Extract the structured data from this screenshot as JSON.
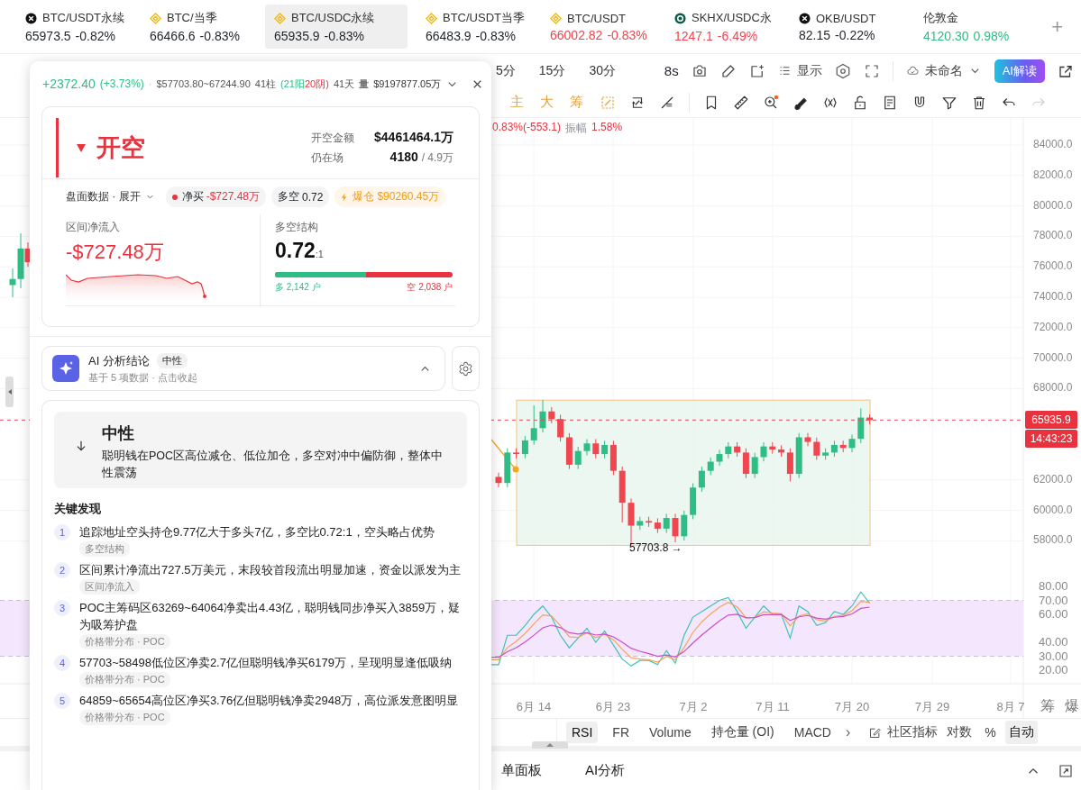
{
  "tickers": [
    {
      "kind": "xcircle",
      "symbol": "BTC/USDT永续",
      "price": "65973.5",
      "change": "-0.82%",
      "color": "#1f2329",
      "selected": false
    },
    {
      "kind": "diamond",
      "symbol": "BTC/当季",
      "price": "66466.6",
      "change": "-0.83%",
      "color": "#1f2329",
      "selected": false
    },
    {
      "kind": "diamond",
      "symbol": "BTC/USDC永续",
      "price": "65935.9",
      "change": "-0.83%",
      "color": "#1f2329",
      "selected": true
    },
    {
      "kind": "diamond",
      "symbol": "BTC/USDT当季",
      "price": "66483.9",
      "change": "-0.83%",
      "color": "#1f2329",
      "selected": false
    },
    {
      "kind": "diamond",
      "symbol": "BTC/USDT",
      "price": "66002.82",
      "change": "-0.83%",
      "color": "#f0464f",
      "selected": false
    },
    {
      "kind": "ring",
      "symbol": "SKHX/USDC永",
      "price": "1247.1",
      "change": "-6.49%",
      "color": "#f0464f",
      "selected": false
    },
    {
      "kind": "xcircle",
      "symbol": "OKB/USDT",
      "price": "82.15",
      "change": "-0.22%",
      "color": "#1f2329",
      "selected": false
    },
    {
      "kind": "plain",
      "symbol": "伦敦金",
      "price": "4120.30",
      "change": "0.98%",
      "color": "#2ebd85",
      "selected": false
    }
  ],
  "add_tab": "+",
  "toolbar": {
    "intervals": [
      {
        "label": "5分",
        "selected": false
      },
      {
        "label": "15分",
        "selected": false
      },
      {
        "label": "30分",
        "selected": false
      }
    ],
    "refresh": "8s",
    "display": "显示",
    "layout_name": "未命名",
    "ai_button": "AI解读"
  },
  "toolbar2": {
    "overlays": [
      "主",
      "大",
      "筹"
    ],
    "redo_disabled": true
  },
  "chart": {
    "change": "0.83%(-553.1)",
    "amplitude_label": "振幅",
    "amplitude": "1.58%",
    "price_labels": [
      "84000.0",
      "82000.0",
      "80000.0",
      "78000.0",
      "76000.0",
      "74000.0",
      "72000.0",
      "70000.0",
      "68000.0",
      "62000.0",
      "60000.0",
      "58000.0"
    ],
    "last_price": "65935.9",
    "countdown": "14:43:23",
    "low_marker": "57703.8 →",
    "rsi_labels": [
      "80.00",
      "70.00",
      "60.00",
      "40.00",
      "30.00",
      "20.00"
    ],
    "dates": [
      "6月 14",
      "6月 23",
      "7月 2",
      "7月 11",
      "7月 20",
      "7月 29",
      "8月 7"
    ],
    "side_labels": [
      "筹",
      "爆"
    ]
  },
  "indicator_tabs": [
    {
      "label": "RSI",
      "selected": true
    },
    {
      "label": "FR",
      "selected": false
    },
    {
      "label": "Volume",
      "selected": false
    },
    {
      "label": "持仓量 (OI)",
      "selected": false
    },
    {
      "label": "MACD",
      "selected": false
    }
  ],
  "indicator_more": "›",
  "community": "社区指标",
  "scale_modes": [
    {
      "label": "对数",
      "selected": false
    },
    {
      "label": "%",
      "selected": false
    },
    {
      "label": "自动",
      "selected": true
    }
  ],
  "bottom_tabs": [
    "单面板",
    "AI分析"
  ],
  "popup": {
    "header": {
      "change": "+2372.40",
      "percent": "(+3.73%)",
      "separator": "·",
      "range": "$57703.80~67244.90",
      "bars": "41柱",
      "up": "(21阳",
      "down": "20阴)",
      "days": "41天",
      "volume_label": "量",
      "volume": "$9197877.05万"
    },
    "signal": {
      "title": "开空",
      "amount_label": "开空金额",
      "amount": "$4461464.1万",
      "remaining_label": "仍在场",
      "remaining": "4180",
      "remaining_total": "/ 4.9万"
    },
    "expand_label": "盘面数据 · 展开",
    "chips": [
      {
        "kind": "net",
        "label": "净买",
        "value": "-$727.48万"
      },
      {
        "kind": "ratio",
        "label": "多空",
        "value": "0.72"
      },
      {
        "kind": "liquidation",
        "label": "爆仓",
        "value": "$90260.45万"
      }
    ],
    "netflow": {
      "label": "区间净流入",
      "value": "-$727.48万"
    },
    "long_short": {
      "label": "多空结构",
      "ratio": "0.72",
      "suffix": ":1",
      "level": 0.512,
      "long": "多 2,142 户",
      "short": "空 2,038 户"
    },
    "ai": {
      "title": "AI 分析结论",
      "badge": "中性",
      "subtitle": "基于 5 项数据 · 点击收起",
      "expanded": true
    },
    "summary": {
      "title": "中性",
      "text": "聪明钱在POC区高位减仓、低位加仓，多空对冲中偏防御，整体中性震荡"
    },
    "findings_title": "关键发现",
    "findings": [
      {
        "number": "1",
        "text": "追踪地址空头持仓9.77亿大于多头7亿，多空比0.72:1，空头略占优势",
        "tag": "多空结构"
      },
      {
        "number": "2",
        "text": "区间累计净流出727.5万美元，末段较首段流出明显加速，资金以派发为主",
        "tag": "区间净流入"
      },
      {
        "number": "3",
        "text": "POC主筹码区63269~64064净卖出4.43亿，聪明钱同步净买入3859万，疑为吸筹护盘",
        "tag": "价格带分布 · POC"
      },
      {
        "number": "4",
        "text": "57703~58498低位区净卖2.7亿但聪明钱净买6179万，呈现明显逢低吸纳",
        "tag": "价格带分布 · POC"
      },
      {
        "number": "5",
        "text": "64859~65654高位区净买3.76亿但聪明钱净卖2948万，高位派发意图明显",
        "tag": "价格带分布 · POC"
      }
    ]
  }
}
